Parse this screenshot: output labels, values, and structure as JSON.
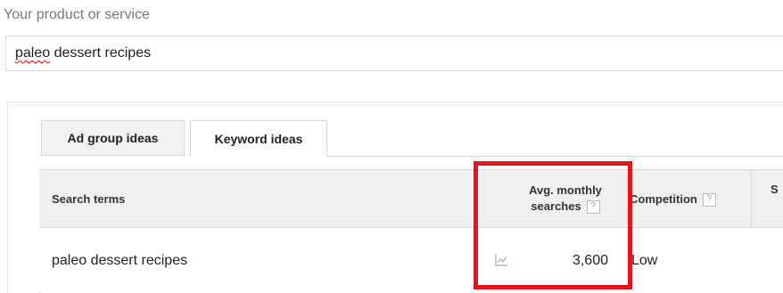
{
  "product_field": {
    "label": "Your product or service",
    "value_underlined": "paleo",
    "value_rest": " dessert recipes"
  },
  "tabs": [
    {
      "label": "Ad group ideas",
      "active": false
    },
    {
      "label": "Keyword ideas",
      "active": true
    }
  ],
  "table": {
    "headers": {
      "search_terms": "Search terms",
      "avg_monthly_line1": "Avg. monthly",
      "avg_monthly_line2": "searches",
      "competition": "Competition",
      "suggested_bid_partial": "S",
      "help_glyph": "?"
    },
    "rows": [
      {
        "term": "paleo dessert recipes",
        "avg_monthly_searches": "3,600",
        "competition": "Low"
      }
    ]
  },
  "highlight_color": "#e8141b"
}
